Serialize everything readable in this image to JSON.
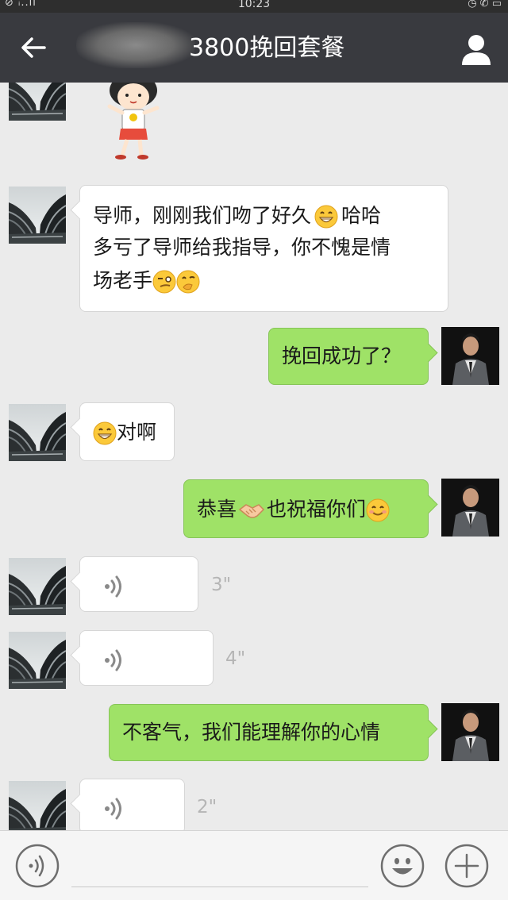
{
  "status": {
    "time": "10:23",
    "signal": "⊘ ᵢ..ıl"
  },
  "header": {
    "title": "3800挽回套餐"
  },
  "messages": [
    {
      "text_line1": "导师，刚刚我们吻了好久",
      "text_line1b": "哈哈",
      "text_line2": "多亏了导师给我指导，你不愧是情",
      "text_line3": "场老手"
    },
    {
      "text": "挽回成功了？"
    },
    {
      "text": "对啊"
    },
    {
      "text_a": "恭喜",
      "text_b": "也祝福你们"
    },
    {
      "duration": "3\""
    },
    {
      "duration": "4\""
    },
    {
      "text": "不客气，我们能理解你的心情"
    },
    {
      "duration": "2\""
    }
  ],
  "icons": {
    "back": "arrow-left-icon",
    "profile": "person-icon",
    "voice": "voice-icon",
    "emoji": "emoji-icon",
    "plus": "plus-icon"
  },
  "colors": {
    "header": "#393a3f",
    "outgoing_bubble": "#9fe267",
    "incoming_bubble": "#ffffff",
    "background": "#ebebeb"
  }
}
